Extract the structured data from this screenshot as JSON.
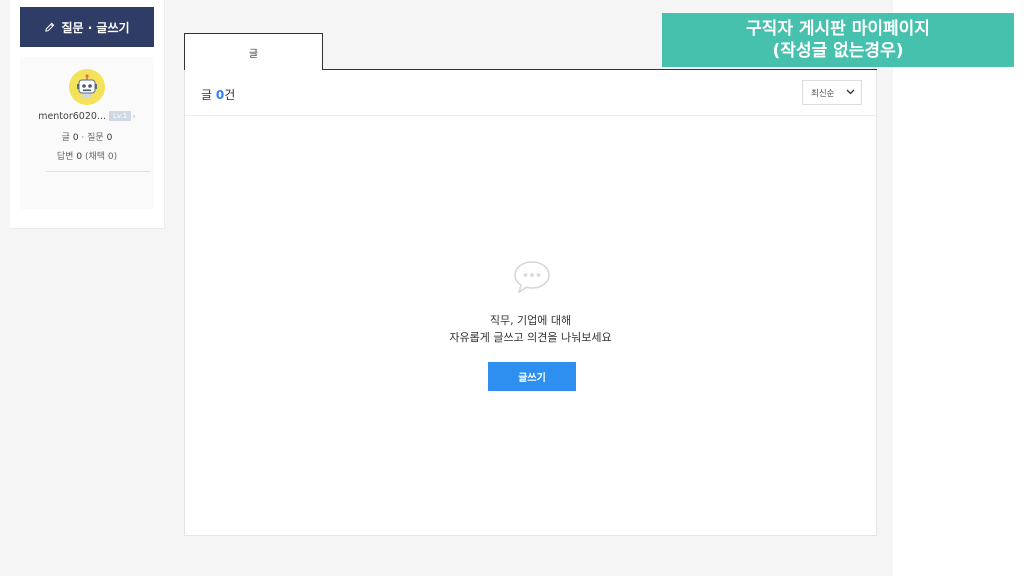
{
  "sidebar": {
    "write_button_label": "질문 · 글쓰기",
    "pencil_icon": "pencil-icon",
    "avatar_icon": "robot-avatar-icon",
    "username": "mentor6020...",
    "grade_badge": "Lv.1",
    "posts_label": "글",
    "posts_count": "0",
    "questions_label": "· 질문",
    "questions_count": "0",
    "answers_label": "답변",
    "answers_count": "0",
    "adopted_text": "(채택 0)"
  },
  "tabs": [
    {
      "label": "글",
      "active": true
    }
  ],
  "content": {
    "count_prefix": "글",
    "count_value": "0",
    "count_suffix": "건",
    "sort_selected": "최신순",
    "empty_icon": "speech-bubble-icon",
    "empty_line1": "직무, 기업에 대해",
    "empty_line2": "자유롭게 글쓰고 의견을 나눠보세요",
    "write_button_label": "글쓰기"
  },
  "annotation": {
    "line1": "구직자 게시판 마이페이지",
    "line2": "(작성글 없는경우)"
  },
  "colors": {
    "sidebar_button": "#2f3d66",
    "accent_blue": "#2f8ff0",
    "banner": "#45c1ad",
    "avatar": "#f3e25a"
  }
}
